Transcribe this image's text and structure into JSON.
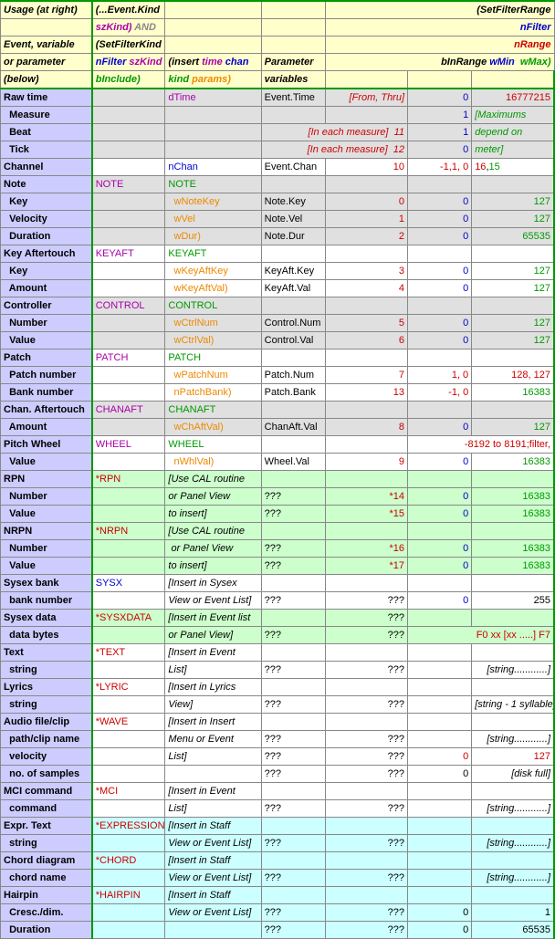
{
  "hdr": {
    "c0a": "Usage (at right)",
    "c0b": "Event, variable",
    "c0c": "or parameter",
    "c0d": "(below)",
    "c1a": "(...Event.Kind",
    "c1b": "szKind",
    "c1c": " AND",
    "c1d": "(SetFilterKind",
    "c1e": "nFilter ",
    "c1f": "szKind",
    "c1g": "bInclude",
    "c2a": "(insert ",
    "c2b": "time",
    "c2c": "chan",
    "c2d": "kind",
    "c2e": "params",
    "c3": "Parameter",
    "c3b": "variables",
    "c4a": "(SetFilterRange",
    "c4b": "nFilter",
    "c4c": "nRange",
    "c4d": "bInRange ",
    "c4e": "wMin ",
    "c4f": "wMax"
  },
  "rows": [
    {
      "bg": "bg-grey",
      "c0": "Raw time",
      "c2": {
        "t": "dTime",
        "cls": "purple"
      },
      "c3": "Event.Time",
      "c4": {
        "t": "[From, Thru]",
        "cls": "red ital tr"
      },
      "c5": {
        "t": "0",
        "cls": "blue tr"
      },
      "c6": {
        "t": "16777215",
        "cls": "red tr"
      }
    },
    {
      "bg": "bg-grey",
      "c0": "  Measure",
      "c5": {
        "t": "1",
        "cls": "blue tr"
      },
      "c6": {
        "t": "[Maximums",
        "cls": "green ital"
      }
    },
    {
      "bg": "bg-grey",
      "c0": "  Beat",
      "c4": {
        "t": "[In each measure]  11",
        "cls": "red ital tr",
        "span2": true
      },
      "c5_skip": true,
      "c5": {
        "t": "1",
        "cls": "blue tr"
      },
      "c6": {
        "t": "depend on",
        "cls": "green ital"
      }
    },
    {
      "bg": "bg-grey",
      "c0": "  Tick",
      "c4": {
        "t": "[In each measure]  12",
        "cls": "red ital tr",
        "span2": true
      },
      "c5_skip": true,
      "c5": {
        "t": "0",
        "cls": "blue tr"
      },
      "c6": {
        "t": "meter]",
        "cls": "green ital"
      }
    },
    {
      "bg": "",
      "c0": "Channel",
      "c2": {
        "t": "nChan",
        "cls": "blue"
      },
      "c3": "Event.Chan",
      "c4": {
        "t": "10",
        "cls": "red tr"
      },
      "c5": {
        "t": "-1,1, 0",
        "cls": "red tr"
      },
      "c6": {
        "t": "16,15",
        "cls": ""
      }
    },
    {
      "bg": "bg-grey",
      "c0": "Note",
      "c1": {
        "t": "NOTE",
        "cls": "purple"
      },
      "c2": {
        "t": "NOTE",
        "cls": "green"
      }
    },
    {
      "bg": "bg-grey",
      "c0": "  Key",
      "c2": {
        "t": "  wNoteKey",
        "cls": "orange"
      },
      "c3": "Note.Key",
      "c4": {
        "t": "0",
        "cls": "red tr"
      },
      "c5": {
        "t": "0",
        "cls": "blue tr"
      },
      "c6": {
        "t": "127",
        "cls": "green tr"
      }
    },
    {
      "bg": "bg-grey",
      "c0": "  Velocity",
      "c2": {
        "t": "  wVel",
        "cls": "orange"
      },
      "c3": "Note.Vel",
      "c4": {
        "t": "1",
        "cls": "red tr"
      },
      "c5": {
        "t": "0",
        "cls": "blue tr"
      },
      "c6": {
        "t": "127",
        "cls": "green tr"
      }
    },
    {
      "bg": "bg-grey",
      "c0": "  Duration",
      "c2": {
        "t": "  wDur)",
        "cls": "orange"
      },
      "c3": "Note.Dur",
      "c4": {
        "t": "2",
        "cls": "red tr"
      },
      "c5": {
        "t": "0",
        "cls": "blue tr"
      },
      "c6": {
        "t": "65535",
        "cls": "green tr"
      }
    },
    {
      "bg": "",
      "c0": "Key Aftertouch",
      "c1": {
        "t": "KEYAFT",
        "cls": "purple"
      },
      "c2": {
        "t": "KEYAFT",
        "cls": "green"
      }
    },
    {
      "bg": "",
      "c0": "  Key",
      "c2": {
        "t": "  wKeyAftKey",
        "cls": "orange"
      },
      "c3": "KeyAft.Key",
      "c4": {
        "t": "3",
        "cls": "red tr"
      },
      "c5": {
        "t": "0",
        "cls": "blue tr"
      },
      "c6": {
        "t": "127",
        "cls": "green tr"
      }
    },
    {
      "bg": "",
      "c0": "  Amount",
      "c2": {
        "t": "  wKeyAftVal)",
        "cls": "orange"
      },
      "c3": "KeyAft.Val",
      "c4": {
        "t": "4",
        "cls": "red tr"
      },
      "c5": {
        "t": "0",
        "cls": "blue tr"
      },
      "c6": {
        "t": "127",
        "cls": "green tr"
      }
    },
    {
      "bg": "bg-grey",
      "c0": "Controller",
      "c1": {
        "t": "CONTROL",
        "cls": "purple"
      },
      "c2": {
        "t": "CONTROL",
        "cls": "green"
      }
    },
    {
      "bg": "bg-grey",
      "c0": "  Number",
      "c2": {
        "t": "  wCtrlNum",
        "cls": "orange"
      },
      "c3": "Control.Num",
      "c4": {
        "t": "5",
        "cls": "red tr"
      },
      "c5": {
        "t": "0",
        "cls": "blue tr"
      },
      "c6": {
        "t": "127",
        "cls": "green tr"
      }
    },
    {
      "bg": "bg-grey",
      "c0": "  Value",
      "c2": {
        "t": "  wCtrlVal)",
        "cls": "orange"
      },
      "c3": "Control.Val",
      "c4": {
        "t": "6",
        "cls": "red tr"
      },
      "c5": {
        "t": "0",
        "cls": "blue tr"
      },
      "c6": {
        "t": "127",
        "cls": "green tr"
      }
    },
    {
      "bg": "",
      "c0": "Patch",
      "c1": {
        "t": "PATCH",
        "cls": "purple"
      },
      "c2": {
        "t": "PATCH",
        "cls": "green"
      }
    },
    {
      "bg": "",
      "c0": "  Patch number",
      "c2": {
        "t": "  wPatchNum",
        "cls": "orange"
      },
      "c3": "Patch.Num",
      "c4": {
        "t": "7",
        "cls": "red tr"
      },
      "c5": {
        "t": "1, 0",
        "cls": "red tr"
      },
      "c6": {
        "t": "128, 127",
        "cls": "red tr"
      }
    },
    {
      "bg": "",
      "c0": "  Bank number",
      "c2": {
        "t": "  nPatchBank)",
        "cls": "orange"
      },
      "c3": "Patch.Bank",
      "c4": {
        "t": "13",
        "cls": "red tr"
      },
      "c5": {
        "t": "-1, 0",
        "cls": "red tr"
      },
      "c6": {
        "t": "16383",
        "cls": "green tr"
      }
    },
    {
      "bg": "bg-grey",
      "c0": "Chan. Aftertouch",
      "c1": {
        "t": "CHANAFT",
        "cls": "purple"
      },
      "c2": {
        "t": "CHANAFT",
        "cls": "green"
      }
    },
    {
      "bg": "bg-grey",
      "c0": "  Amount",
      "c2": {
        "t": "  wChAftVal)",
        "cls": "orange"
      },
      "c3": "ChanAft.Val",
      "c4": {
        "t": "8",
        "cls": "red tr"
      },
      "c5": {
        "t": "0",
        "cls": "blue tr"
      },
      "c6": {
        "t": "127",
        "cls": "green tr"
      }
    },
    {
      "bg": "",
      "c0": "Pitch Wheel",
      "c1": {
        "t": "WHEEL",
        "cls": "purple"
      },
      "c2": {
        "t": "WHEEL",
        "cls": "green"
      },
      "c5": {
        "t": "-8192 to 8191;filter,",
        "cls": "red tr",
        "spanL": true
      }
    },
    {
      "bg": "",
      "c0": "  Value",
      "c2": {
        "t": "  nWhlVal)",
        "cls": "orange"
      },
      "c3": "Wheel.Val",
      "c4": {
        "t": "9",
        "cls": "red tr"
      },
      "c5": {
        "t": "0",
        "cls": "blue tr"
      },
      "c6": {
        "t": "16383",
        "cls": "green tr"
      }
    },
    {
      "bg": "bg-ltgrn",
      "c0": "RPN",
      "c1": {
        "t": "*RPN",
        "cls": "red"
      },
      "c2": {
        "t": "[Use CAL routine",
        "cls": "ital"
      }
    },
    {
      "bg": "bg-ltgrn",
      "c0": "  Number",
      "c2": {
        "t": "or Panel View",
        "cls": "ital"
      },
      "c3": "???",
      "c4": {
        "t": "*14",
        "cls": "red tr"
      },
      "c5": {
        "t": "0",
        "cls": "blue tr"
      },
      "c6": {
        "t": "16383",
        "cls": "green tr"
      }
    },
    {
      "bg": "bg-ltgrn",
      "c0": "  Value",
      "c2": {
        "t": "to insert]",
        "cls": "ital"
      },
      "c3": "???",
      "c4": {
        "t": "*15",
        "cls": "red tr"
      },
      "c5": {
        "t": "0",
        "cls": "blue tr"
      },
      "c6": {
        "t": "16383",
        "cls": "green tr"
      }
    },
    {
      "bg": "bg-ltgrn",
      "c0": "NRPN",
      "c1": {
        "t": "*NRPN",
        "cls": "red"
      },
      "c2": {
        "t": "[Use CAL routine",
        "cls": "ital"
      }
    },
    {
      "bg": "bg-ltgrn",
      "c0": "  Number",
      "c2": {
        "t": " or Panel View",
        "cls": "ital"
      },
      "c3": "???",
      "c4": {
        "t": "*16",
        "cls": "red tr"
      },
      "c5": {
        "t": "0",
        "cls": "blue tr"
      },
      "c6": {
        "t": "16383",
        "cls": "green tr"
      }
    },
    {
      "bg": "bg-ltgrn",
      "c0": "  Value",
      "c2": {
        "t": "to insert]",
        "cls": "ital"
      },
      "c3": "???",
      "c4": {
        "t": "*17",
        "cls": "red tr"
      },
      "c5": {
        "t": "0",
        "cls": "blue tr"
      },
      "c6": {
        "t": "16383",
        "cls": "green tr"
      }
    },
    {
      "bg": "",
      "c0": "Sysex bank",
      "c1": {
        "t": "SYSX",
        "cls": "blue"
      },
      "c2": {
        "t": "[Insert in Sysex",
        "cls": "ital"
      }
    },
    {
      "bg": "",
      "c0": "  bank number",
      "c2": {
        "t": "View or Event List]",
        "cls": "ital"
      },
      "c3": "???",
      "c4": {
        "t": "???",
        "cls": "tr"
      },
      "c5": {
        "t": "0",
        "cls": "blue tr"
      },
      "c6": {
        "t": "255",
        "cls": "tr"
      }
    },
    {
      "bg": "bg-ltgrn",
      "c0": "Sysex data",
      "c1": {
        "t": "*SYSXDATA",
        "cls": "red"
      },
      "c2": {
        "t": "[Insert in Event list",
        "cls": "ital"
      },
      "c4": {
        "t": "???",
        "cls": "tr"
      }
    },
    {
      "bg": "bg-ltgrn",
      "c0": "  data bytes",
      "c2": {
        "t": "or Panel View]",
        "cls": "ital"
      },
      "c3": "???",
      "c4": {
        "t": "???",
        "cls": "tr"
      },
      "c5": {
        "t": "F0 xx [xx .....] F7",
        "cls": "red tr",
        "spanL": true
      }
    },
    {
      "bg": "",
      "c0": "Text",
      "c1": {
        "t": "*TEXT",
        "cls": "red"
      },
      "c2": {
        "t": "[Insert in Event",
        "cls": "ital"
      }
    },
    {
      "bg": "",
      "c0": "  string",
      "c2": {
        "t": "List]",
        "cls": "ital"
      },
      "c3": "???",
      "c4": {
        "t": "???",
        "cls": "tr"
      },
      "c6": {
        "t": "[string............]",
        "cls": "ital tr"
      }
    },
    {
      "bg": "",
      "c0": "Lyrics",
      "c1": {
        "t": "*LYRIC",
        "cls": "red"
      },
      "c2": {
        "t": "[Insert in Lyrics",
        "cls": "ital"
      }
    },
    {
      "bg": "",
      "c0": "  string",
      "c2": {
        "t": "View]",
        "cls": "ital"
      },
      "c3": "???",
      "c4": {
        "t": "???",
        "cls": "tr"
      },
      "c6": {
        "t": "[string - 1 syllable]",
        "cls": "ital tr"
      }
    },
    {
      "bg": "",
      "c0": "Audio file/clip",
      "c1": {
        "t": "*WAVE",
        "cls": "red"
      },
      "c2": {
        "t": "[Insert in Insert",
        "cls": "ital"
      }
    },
    {
      "bg": "",
      "c0": "  path/clip name",
      "c2": {
        "t": "Menu or Event",
        "cls": "ital"
      },
      "c3": "???",
      "c4": {
        "t": "???",
        "cls": "tr"
      },
      "c6": {
        "t": "[string............]",
        "cls": "ital tr"
      }
    },
    {
      "bg": "",
      "c0": "  velocity",
      "c2": {
        "t": "List]",
        "cls": "ital"
      },
      "c3": "???",
      "c4": {
        "t": "???",
        "cls": "tr"
      },
      "c5": {
        "t": "0",
        "cls": "red tr"
      },
      "c6": {
        "t": "127",
        "cls": "red tr"
      }
    },
    {
      "bg": "",
      "c0": "  no. of samples",
      "c3": "???",
      "c4": {
        "t": "???",
        "cls": "tr"
      },
      "c5": {
        "t": "0",
        "cls": "tr"
      },
      "c6": {
        "t": "[disk full]",
        "cls": "ital tr"
      }
    },
    {
      "bg": "",
      "c0": "MCI command",
      "c1": {
        "t": "*MCI",
        "cls": "red"
      },
      "c2": {
        "t": "[Insert in Event",
        "cls": "ital"
      }
    },
    {
      "bg": "",
      "c0": "  command",
      "c2": {
        "t": "List]",
        "cls": "ital"
      },
      "c3": "???",
      "c4": {
        "t": "???",
        "cls": "tr"
      },
      "c6": {
        "t": "[string............]",
        "cls": "ital tr"
      }
    },
    {
      "bg": "bg-cyan",
      "c0": "Expr. Text",
      "c1": {
        "t": "*EXPRESSION",
        "cls": "red"
      },
      "c2": {
        "t": "[Insert in Staff",
        "cls": "ital"
      }
    },
    {
      "bg": "bg-cyan",
      "c0": "  string",
      "c2": {
        "t": "View or Event List]",
        "cls": "ital"
      },
      "c3": "???",
      "c4": {
        "t": "???",
        "cls": "tr"
      },
      "c6": {
        "t": "[string............]",
        "cls": "ital tr"
      }
    },
    {
      "bg": "bg-cyan",
      "c0": "Chord diagram",
      "c1": {
        "t": "*CHORD",
        "cls": "red"
      },
      "c2": {
        "t": "[Insert in Staff",
        "cls": "ital"
      }
    },
    {
      "bg": "bg-cyan",
      "c0": "  chord name",
      "c2": {
        "t": "View or Event List]",
        "cls": "ital"
      },
      "c3": "???",
      "c4": {
        "t": "???",
        "cls": "tr"
      },
      "c6": {
        "t": "[string............]",
        "cls": "ital tr"
      }
    },
    {
      "bg": "bg-cyan",
      "c0": "Hairpin",
      "c1": {
        "t": "*HAIRPIN",
        "cls": "red"
      },
      "c2": {
        "t": "[Insert in Staff",
        "cls": "ital"
      }
    },
    {
      "bg": "bg-cyan",
      "c0": "  Cresc./dim.",
      "c2": {
        "t": "View or Event List]",
        "cls": "ital"
      },
      "c3": "???",
      "c4": {
        "t": "???",
        "cls": "tr"
      },
      "c5": {
        "t": "0",
        "cls": "tr"
      },
      "c6": {
        "t": "1",
        "cls": "tr"
      }
    },
    {
      "bg": "bg-cyan",
      "c0": "  Duration",
      "c3": "???",
      "c4": {
        "t": "???",
        "cls": "tr"
      },
      "c5": {
        "t": "0",
        "cls": "tr"
      },
      "c6": {
        "t": "65535",
        "cls": "tr"
      }
    }
  ]
}
